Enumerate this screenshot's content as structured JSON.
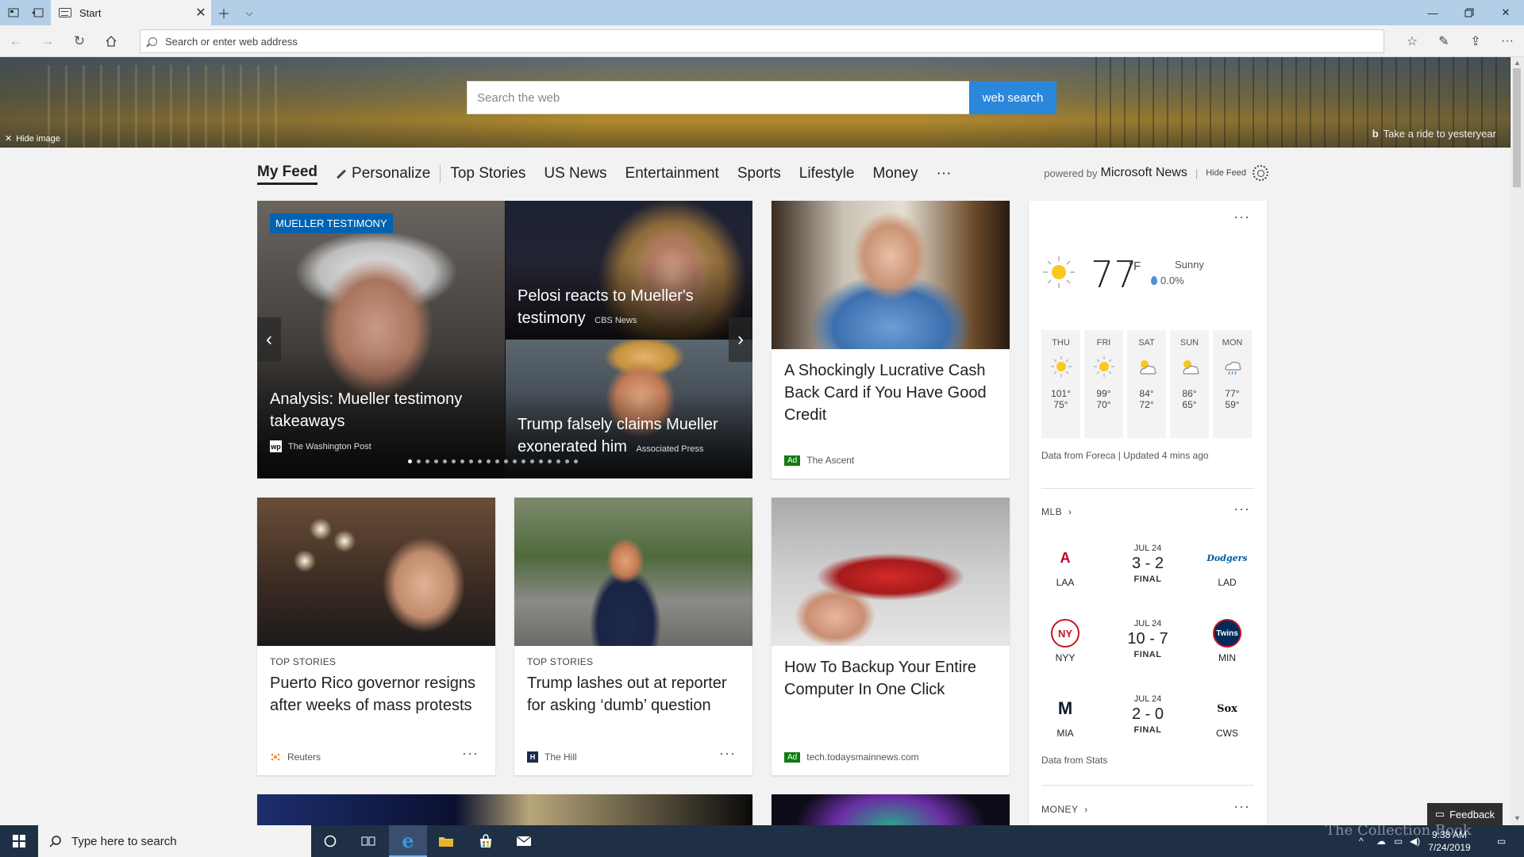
{
  "browser": {
    "tab_title": "Start",
    "address_placeholder": "Search or enter web address"
  },
  "hero": {
    "search_placeholder": "Search the web",
    "search_button": "web search",
    "hide_image": "Hide image",
    "image_caption": "Take a ride to yesteryear"
  },
  "feed_nav": {
    "items": [
      "My Feed",
      "Personalize",
      "Top Stories",
      "US News",
      "Entertainment",
      "Sports",
      "Lifestyle",
      "Money",
      "···"
    ],
    "powered_prefix": "powered by",
    "powered_brand": "Microsoft News",
    "hide_feed": "Hide Feed"
  },
  "carousel": {
    "badge": "MUELLER TESTIMONY",
    "main": {
      "headline": "Analysis: Mueller testimony takeaways",
      "source": "The Washington Post",
      "source_icon": "wp"
    },
    "top": {
      "headline": "Pelosi reacts to Mueller's testimony",
      "source": "CBS News"
    },
    "bottom": {
      "headline": "Trump falsely claims Mueller exonerated him",
      "source": "Associated Press"
    },
    "page_count": 20,
    "active_page": 0
  },
  "cards": {
    "ad1": {
      "headline": "A Shockingly Lucrative Cash Back Card if You Have Good Credit",
      "ad_label": "Ad",
      "source": "The Ascent"
    },
    "pr": {
      "category": "TOP STORIES",
      "headline": "Puerto Rico governor resigns after weeks of mass protests",
      "source": "Reuters"
    },
    "trump": {
      "category": "TOP STORIES",
      "headline": "Trump lashes out at reporter for asking ‘dumb’ question",
      "source": "The Hill",
      "source_icon": "H"
    },
    "usb": {
      "headline": "How To Backup Your Entire Computer In One Click",
      "ad_label": "Ad",
      "source": "tech.todaysmainnews.com"
    },
    "more": "···"
  },
  "weather": {
    "temp": "77",
    "unit": "°F",
    "condition": "Sunny",
    "precip": "0.0%",
    "forecast": [
      {
        "day": "THU",
        "icon": "sun-icon",
        "hi": "101°",
        "lo": "75°"
      },
      {
        "day": "FRI",
        "icon": "sun-icon",
        "hi": "99°",
        "lo": "70°"
      },
      {
        "day": "SAT",
        "icon": "partly-cloudy-icon",
        "hi": "84°",
        "lo": "72°"
      },
      {
        "day": "SUN",
        "icon": "partly-cloudy-icon",
        "hi": "86°",
        "lo": "65°"
      },
      {
        "day": "MON",
        "icon": "rain-icon",
        "hi": "77°",
        "lo": "59°"
      }
    ],
    "source": "Data from Foreca | Updated 4 mins ago"
  },
  "mlb": {
    "header": "MLB",
    "games": [
      {
        "home": "LAA",
        "away": "LAD",
        "date": "JUL 24",
        "score": "3 - 2",
        "status": "FINAL",
        "home_logo": "A",
        "away_logo": "Dodgers",
        "home_color": "#ba0021",
        "away_color": "#005a9c"
      },
      {
        "home": "NYY",
        "away": "MIN",
        "date": "JUL 24",
        "score": "10 - 7",
        "status": "FINAL",
        "home_logo": "NY",
        "away_logo": "Twins",
        "home_color": "#c4161c",
        "away_color": "#002b5c"
      },
      {
        "home": "MIA",
        "away": "CWS",
        "date": "JUL 24",
        "score": "2 - 0",
        "status": "FINAL",
        "home_logo": "M",
        "away_logo": "Sox",
        "home_color": "#0e1a2b",
        "away_color": "#111111"
      }
    ],
    "source": "Data from Stats"
  },
  "money": {
    "header": "MONEY"
  },
  "feedback": "Feedback",
  "taskbar": {
    "search_placeholder": "Type here to search",
    "time": "9:38 AM",
    "date": "7/24/2019"
  },
  "watermark": "The Collection Book",
  "colors": {
    "accent": "#2b87d9",
    "badge": "#0063b1",
    "ad": "#107c10",
    "taskbar": "#1f2f45"
  }
}
